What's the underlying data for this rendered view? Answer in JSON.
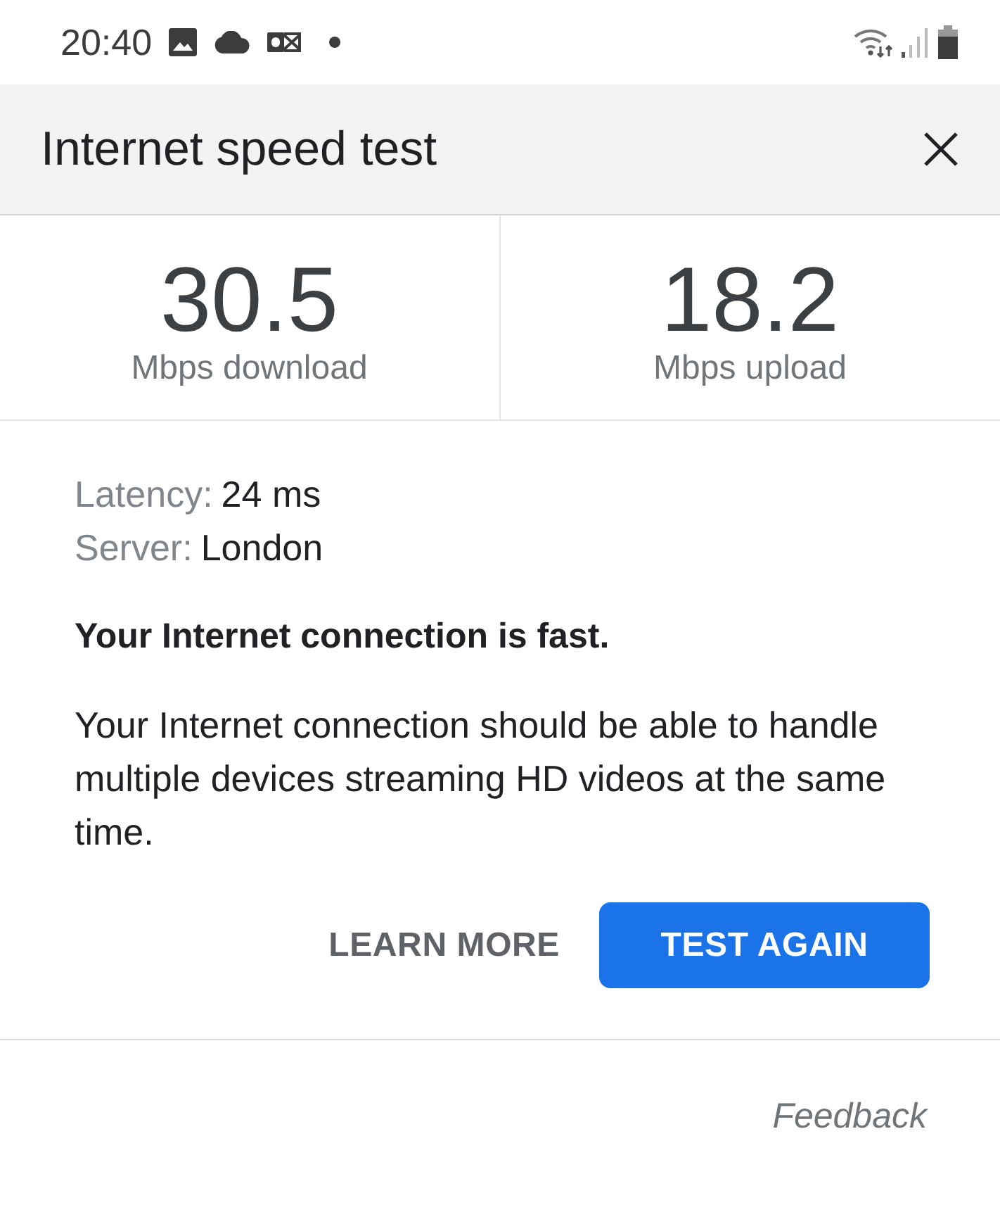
{
  "status_bar": {
    "time": "20:40"
  },
  "dialog": {
    "title": "Internet speed test"
  },
  "results": [
    {
      "value": "30.5",
      "label": "Mbps download"
    },
    {
      "value": "18.2",
      "label": "Mbps upload"
    }
  ],
  "details": [
    {
      "label": "Latency:",
      "value": "24 ms"
    },
    {
      "label": "Server:",
      "value": "London"
    }
  ],
  "verdict": "Your Internet connection is fast.",
  "description": "Your Internet connection should be able to handle multiple devices streaming HD videos at the same time.",
  "actions": [
    {
      "label": "LEARN MORE",
      "kind": "text"
    },
    {
      "label": "TEST AGAIN",
      "kind": "filled"
    }
  ],
  "feedback": "Feedback"
}
